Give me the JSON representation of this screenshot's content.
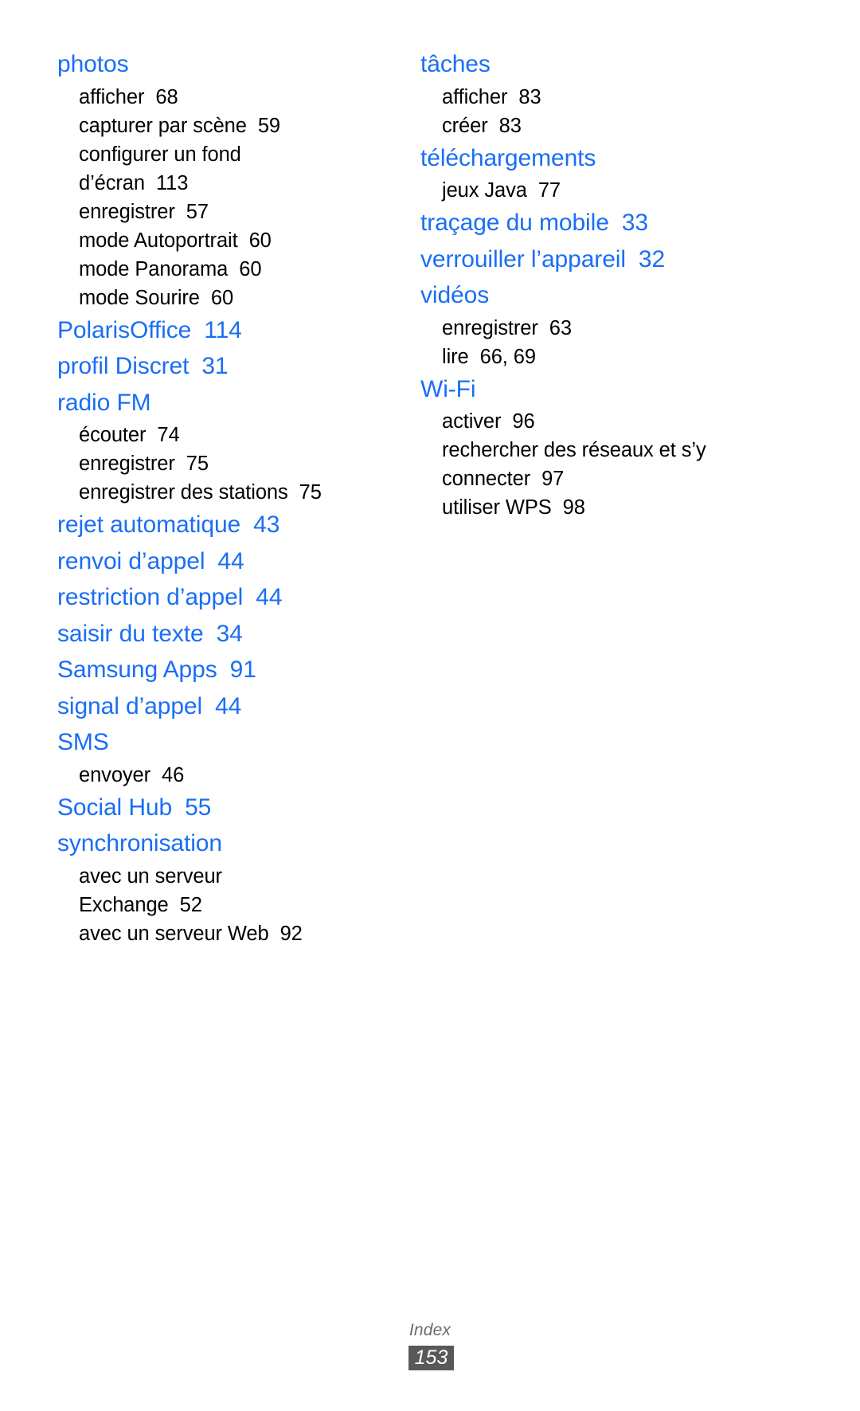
{
  "document": {
    "type": "index-page",
    "language": "fr",
    "footer_label": "Index",
    "page_number": "153",
    "heading_color": "#1a6ef5",
    "body_color": "#000000",
    "badge_background": "#595959",
    "badge_text_color": "#ffffff"
  },
  "columns": {
    "left": [
      {
        "heading": "photos",
        "heading_page": "",
        "subs": [
          {
            "label": "afficher",
            "page": "68"
          },
          {
            "label": "capturer par scène",
            "page": "59"
          },
          {
            "label": "configurer un fond",
            "page": ""
          },
          {
            "label": "d’écran",
            "page": "113"
          },
          {
            "label": "enregistrer",
            "page": "57"
          },
          {
            "label": "mode Autoportrait",
            "page": "60"
          },
          {
            "label": "mode Panorama",
            "page": "60"
          },
          {
            "label": "mode Sourire",
            "page": "60"
          }
        ]
      },
      {
        "heading": "PolarisOffice",
        "heading_page": "114",
        "subs": []
      },
      {
        "heading": "profil Discret",
        "heading_page": "31",
        "subs": []
      },
      {
        "heading": "radio FM",
        "heading_page": "",
        "subs": [
          {
            "label": "écouter",
            "page": "74"
          },
          {
            "label": "enregistrer",
            "page": "75"
          },
          {
            "label": "enregistrer des stations",
            "page": "75"
          }
        ]
      },
      {
        "heading": "rejet automatique",
        "heading_page": "43",
        "subs": []
      },
      {
        "heading": "renvoi d’appel",
        "heading_page": "44",
        "subs": []
      },
      {
        "heading": "restriction d’appel",
        "heading_page": "44",
        "subs": []
      },
      {
        "heading": "saisir du texte",
        "heading_page": "34",
        "subs": []
      },
      {
        "heading": "Samsung Apps",
        "heading_page": "91",
        "subs": []
      },
      {
        "heading": "signal d’appel",
        "heading_page": "44",
        "subs": []
      },
      {
        "heading": "SMS",
        "heading_page": "",
        "subs": [
          {
            "label": "envoyer",
            "page": "46"
          }
        ]
      },
      {
        "heading": "Social Hub",
        "heading_page": "55",
        "subs": []
      },
      {
        "heading": "synchronisation",
        "heading_page": "",
        "subs": [
          {
            "label": "avec un serveur",
            "page": ""
          },
          {
            "label": "Exchange",
            "page": "52"
          },
          {
            "label": "avec un serveur Web",
            "page": "92"
          }
        ]
      }
    ],
    "right": [
      {
        "heading": "tâches",
        "heading_page": "",
        "subs": [
          {
            "label": "afficher",
            "page": "83"
          },
          {
            "label": "créer",
            "page": "83"
          }
        ]
      },
      {
        "heading": "téléchargements",
        "heading_page": "",
        "subs": [
          {
            "label": "jeux Java",
            "page": "77"
          }
        ]
      },
      {
        "heading": "traçage du mobile",
        "heading_page": "33",
        "subs": []
      },
      {
        "heading": "verrouiller l’appareil",
        "heading_page": "32",
        "subs": []
      },
      {
        "heading": "vidéos",
        "heading_page": "",
        "subs": [
          {
            "label": "enregistrer",
            "page": "63"
          },
          {
            "label": "lire",
            "page": "66, 69"
          }
        ]
      },
      {
        "heading": "Wi-Fi",
        "heading_page": "",
        "subs": [
          {
            "label": "activer",
            "page": "96"
          },
          {
            "label": "rechercher des réseaux et s’y",
            "page": ""
          },
          {
            "label": "connecter",
            "page": "97"
          },
          {
            "label": "utiliser WPS",
            "page": "98"
          }
        ]
      }
    ]
  }
}
